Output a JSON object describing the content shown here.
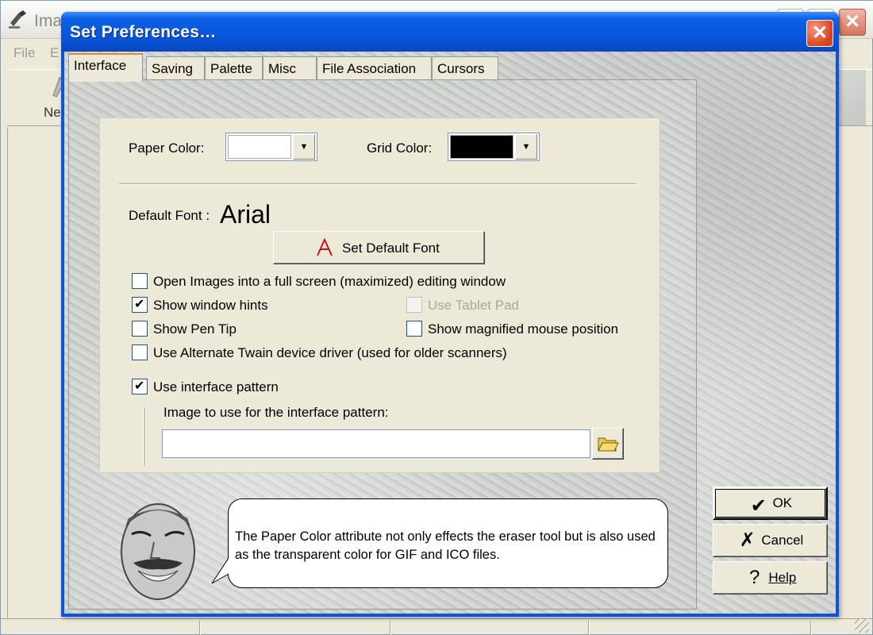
{
  "background_app": {
    "title": "Ima",
    "menu": [
      "File",
      "E"
    ],
    "toolbar_new_label": "New"
  },
  "dialog": {
    "title": "Set Preferences…",
    "close_symbol": "✕",
    "tabs": [
      {
        "label": "Interface",
        "active": true
      },
      {
        "label": "Saving",
        "active": false
      },
      {
        "label": "Palette",
        "active": false
      },
      {
        "label": "Misc",
        "active": false
      },
      {
        "label": "File Association",
        "active": false
      },
      {
        "label": "Cursors",
        "active": false
      }
    ]
  },
  "interface": {
    "paper_color_label": "Paper Color:",
    "paper_color_value": "#ffffff",
    "grid_color_label": "Grid Color:",
    "grid_color_value": "#000000",
    "default_font_label": "Default Font :",
    "default_font_value": "Arial",
    "set_default_font_label": "Set Default Font",
    "checkboxes": {
      "open_full_screen": {
        "label": "Open Images into a full screen (maximized) editing window",
        "checked": false
      },
      "show_window_hints": {
        "label": "Show window hints",
        "checked": true
      },
      "use_tablet_pad": {
        "label": "Use Tablet Pad",
        "checked": false,
        "disabled": true
      },
      "show_pen_tip": {
        "label": "Show Pen Tip",
        "checked": false
      },
      "show_magnified_mouse": {
        "label": "Show magnified mouse position",
        "checked": false
      },
      "alternate_twain": {
        "label": "Use Alternate Twain device driver (used for older scanners)",
        "checked": false
      },
      "use_interface_pattern": {
        "label": "Use interface pattern",
        "checked": true
      }
    },
    "pattern_image_label": "Image to use for the interface pattern:",
    "pattern_image_value": ""
  },
  "hint": {
    "text": "The Paper Color attribute not only effects the eraser tool but is also used as the transparent color for GIF and ICO files."
  },
  "buttons": {
    "ok": "OK",
    "cancel": "Cancel",
    "help": "Help"
  },
  "colors": {
    "titlebar_blue": "#0a55e0",
    "dialog_face": "#ece9d8",
    "tab_highlight": "#e68b2c"
  }
}
